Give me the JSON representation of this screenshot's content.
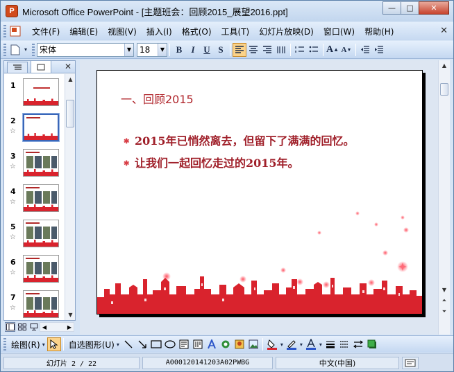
{
  "window": {
    "title": "Microsoft Office PowerPoint - [主题班会：回顾2015_展望2016.ppt]",
    "app_icon_letter": "P",
    "minimize": "—",
    "maximize": "□",
    "close": "✕"
  },
  "menu": {
    "items": [
      "文件(F)",
      "编辑(E)",
      "视图(V)",
      "插入(I)",
      "格式(O)",
      "工具(T)",
      "幻灯片放映(D)",
      "窗口(W)",
      "帮助(H)"
    ],
    "close_glyph": "✕"
  },
  "format_toolbar": {
    "font_name": "宋体",
    "font_size": "18",
    "bold": "B",
    "italic": "I",
    "underline": "U",
    "shadow": "S",
    "grow_font": "A",
    "shrink_font": "A"
  },
  "pane": {
    "tabs": [
      "outline",
      "slides"
    ],
    "close_glyph": "✕",
    "slides": [
      {
        "number": "1",
        "star": ""
      },
      {
        "number": "2",
        "star": "☆"
      },
      {
        "number": "3",
        "star": "☆"
      },
      {
        "number": "4",
        "star": "☆"
      },
      {
        "number": "5",
        "star": "☆"
      },
      {
        "number": "6",
        "star": "☆"
      },
      {
        "number": "7",
        "star": "☆"
      }
    ],
    "selected_slide": "2"
  },
  "slide": {
    "title": "一、回顾2015",
    "bullets": [
      "2015年已悄然离去，但留下了满满的回忆。",
      "让我们一起回忆走过的2015年。"
    ],
    "accent_color": "#d9232d"
  },
  "draw_toolbar": {
    "draw_label": "绘图(R)",
    "autoshapes_label": "自选图形(U)"
  },
  "status": {
    "slide_info": "幻灯片 2 / 22",
    "template": "A000120141203A02PWBG",
    "language": "中文(中国)"
  }
}
